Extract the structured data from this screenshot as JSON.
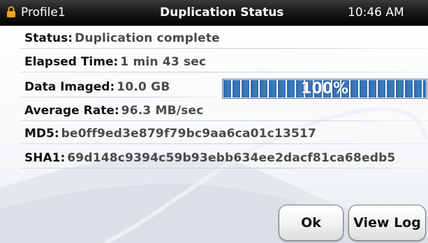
{
  "titlebar": {
    "profile": "Profile1",
    "title": "Duplication Status",
    "clock": "10:46 AM",
    "lock_icon": "lock-icon",
    "lock_color": "#f0a020"
  },
  "rows": {
    "status": {
      "label": "Status",
      "separator": ":",
      "value": "Duplication complete"
    },
    "elapsed": {
      "label": "Elapsed Time",
      "separator": ":",
      "value": "1 min 43 sec"
    },
    "imaged": {
      "label": "Data Imaged",
      "separator": ":",
      "value": "10.0 GB"
    },
    "rate": {
      "label": "Average Rate",
      "separator": ":",
      "value": "96.3 MB/sec"
    },
    "md5": {
      "label": "MD5",
      "separator": ":",
      "value": "be0ff9ed3e879f79bc9aa6ca01c13517"
    },
    "sha1": {
      "label": "SHA1",
      "separator": ":",
      "value": "69d148c9394c59b93ebb634ee2dacf81ca68edb5"
    }
  },
  "progress": {
    "percent": 100,
    "label": "100%",
    "fill_color": "#3a78bd"
  },
  "buttons": {
    "ok": "Ok",
    "view_log": "View Log"
  }
}
